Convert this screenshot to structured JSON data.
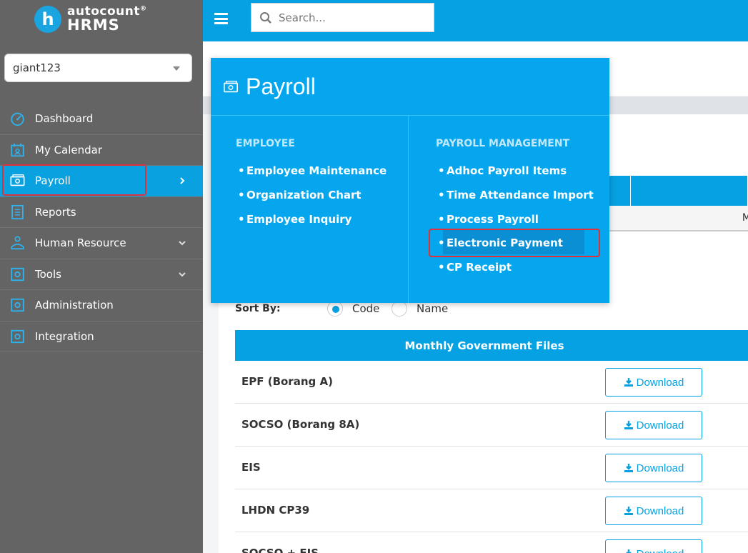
{
  "brand": {
    "badge": "h",
    "line1": "autocount",
    "line2": "HRMS",
    "mark": "®"
  },
  "company": {
    "selected": "giant123"
  },
  "search": {
    "placeholder": "Search..."
  },
  "nav": {
    "items": [
      {
        "label": "Dashboard",
        "icon": "dashboard-icon"
      },
      {
        "label": "My Calendar",
        "icon": "calendar-icon"
      },
      {
        "label": "Payroll",
        "icon": "payroll-icon",
        "active": true
      },
      {
        "label": "Reports",
        "icon": "reports-icon"
      },
      {
        "label": "Human Resource",
        "icon": "human-resource-icon"
      },
      {
        "label": "Tools",
        "icon": "tools-icon"
      },
      {
        "label": "Administration",
        "icon": "administration-icon"
      },
      {
        "label": "Integration",
        "icon": "integration-icon"
      }
    ]
  },
  "mega_menu": {
    "title": "Payroll",
    "employee": {
      "heading": "EMPLOYEE",
      "links": [
        "Employee Maintenance",
        "Organization Chart",
        "Employee Inquiry"
      ]
    },
    "payroll_management": {
      "heading": "PAYROLL MANAGEMENT",
      "links": [
        "Adhoc Payroll Items",
        "Time Attendance Import",
        "Process Payroll",
        "Electronic Payment",
        "CP Receipt"
      ],
      "selected": "Electronic Payment"
    }
  },
  "table_fragment": {
    "cell": "M"
  },
  "sort": {
    "label": "Sort By:",
    "options": [
      "Code",
      "Name"
    ],
    "selected": "Code"
  },
  "gov_files": {
    "title": "Monthly Government Files",
    "download_label": "Download",
    "rows": [
      "EPF (Borang A)",
      "SOCSO (Borang 8A)",
      "EIS",
      "LHDN CP39",
      "SOCSO + EIS"
    ]
  },
  "colors": {
    "primary": "#06a1e2",
    "sidebar": "#646464",
    "highlight": "#e0303a"
  }
}
